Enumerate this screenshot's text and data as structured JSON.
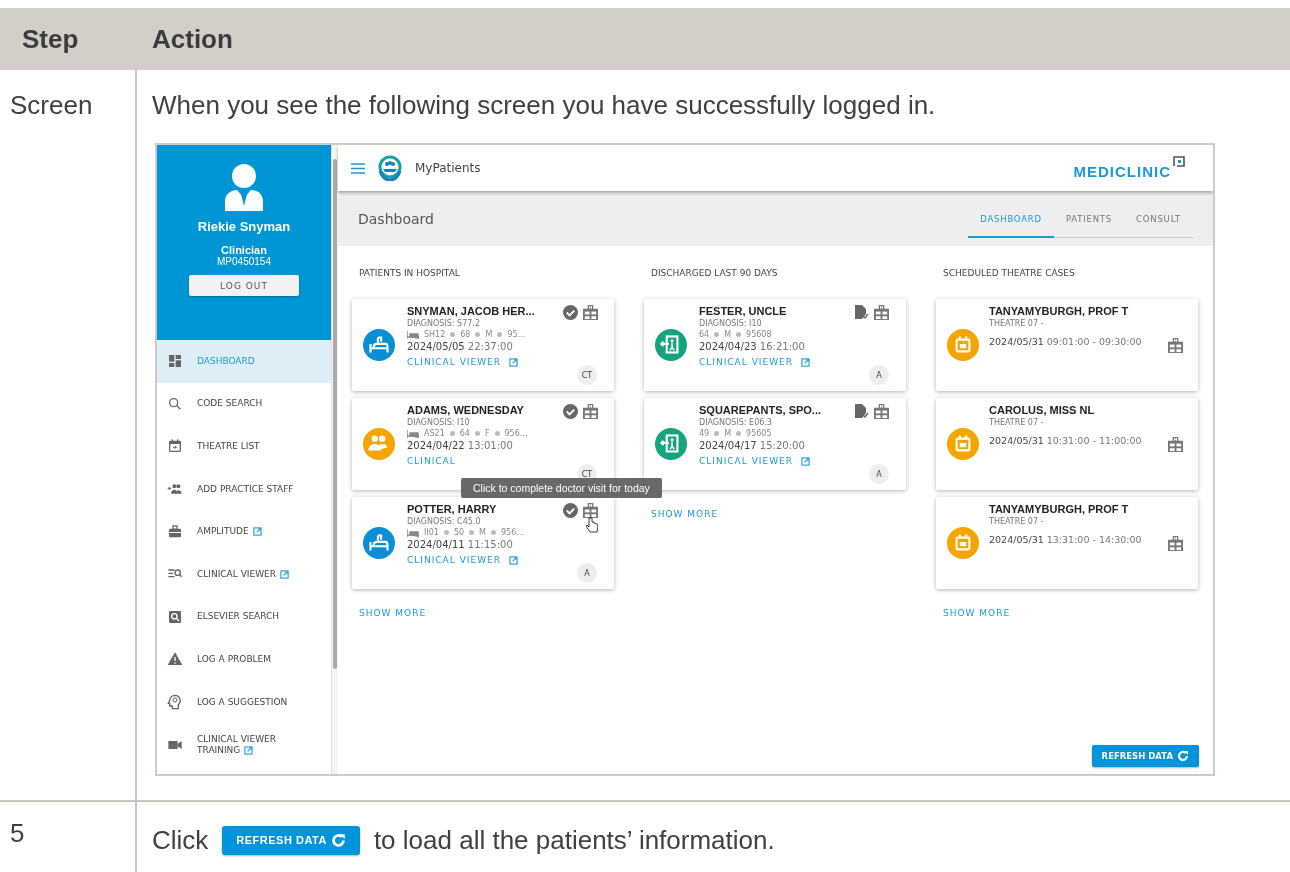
{
  "table": {
    "columns": [
      "Step",
      "Action"
    ],
    "rows": [
      {
        "step": "Screen",
        "text": "When you see the following screen you have successfully logged in.",
        "screenshot": {
          "sidebar": {
            "user": {
              "name": "Riekie Snyman",
              "role": "Clinician",
              "id": "MP0450154"
            },
            "logout": "LOG OUT",
            "items": [
              {
                "label": "DASHBOARD",
                "selected": true,
                "external": false
              },
              {
                "label": "CODE SEARCH",
                "selected": false,
                "external": false
              },
              {
                "label": "THEATRE LIST",
                "selected": false,
                "external": false
              },
              {
                "label": "ADD PRACTICE STAFF",
                "selected": false,
                "external": false
              },
              {
                "label": "AMPLITUDE",
                "selected": false,
                "external": true
              },
              {
                "label": "CLINICAL VIEWER",
                "selected": false,
                "external": true
              },
              {
                "label": "ELSEVIER SEARCH",
                "selected": false,
                "external": false
              },
              {
                "label": "LOG A PROBLEM",
                "selected": false,
                "external": false
              },
              {
                "label": "LOG A SUGGESTION",
                "selected": false,
                "external": false
              },
              {
                "label": "CLINICAL VIEWER TRAINING",
                "selected": false,
                "external": true
              }
            ]
          },
          "app_title": "MyPatients",
          "brand": "MEDICLINIC",
          "page_title": "Dashboard",
          "tabs": [
            {
              "label": "DASHBOARD",
              "selected": true
            },
            {
              "label": "PATIENTS",
              "selected": false
            },
            {
              "label": "CONSULT",
              "selected": false
            }
          ],
          "sections": [
            {
              "title": "PATIENTS IN HOSPITAL",
              "show_more": "SHOW MORE",
              "cards": [
                {
                  "kind": "admitted",
                  "name": "SNYMAN, JACOB HER...",
                  "diagnosis": "DIAGNOSIS: S77.2",
                  "details": [
                    "SH12",
                    "68",
                    "M",
                    "95..."
                  ],
                  "date": "2024/05/05",
                  "time": "22:37:00",
                  "link": "CLINICAL VIEWER",
                  "badge": "CT"
                },
                {
                  "kind": "referred",
                  "name": "ADAMS, WEDNESDAY",
                  "diagnosis": "DIAGNOSIS: I10",
                  "details": [
                    "AS21",
                    "64",
                    "F",
                    "956..."
                  ],
                  "date": "2024/04/22",
                  "time": "13:01:00",
                  "link": "CLINICAL",
                  "badge": "CT"
                },
                {
                  "kind": "admitted",
                  "name": "POTTER, HARRY",
                  "diagnosis": "DIAGNOSIS: C45.0",
                  "details": [
                    "II01",
                    "50",
                    "M",
                    "956..."
                  ],
                  "date": "2024/04/11",
                  "time": "11:15:00",
                  "link": "CLINICAL VIEWER",
                  "badge": "A"
                }
              ]
            },
            {
              "title": "DISCHARGED LAST 90 DAYS",
              "show_more": "SHOW MORE",
              "cards": [
                {
                  "kind": "discharged",
                  "name": "FESTER, UNCLE",
                  "diagnosis": "DIAGNOSIS: I10",
                  "details": [
                    "64",
                    "M",
                    "95608"
                  ],
                  "date": "2024/04/23",
                  "time": "16:21:00",
                  "link": "CLINICAL VIEWER",
                  "badge": "A"
                },
                {
                  "kind": "discharged",
                  "name": "SQUAREPANTS, SPO...",
                  "diagnosis": "DIAGNOSIS: E06.3",
                  "details": [
                    "49",
                    "M",
                    "95605"
                  ],
                  "date": "2024/04/17",
                  "time": "15:20:00",
                  "link": "CLINICAL VIEWER",
                  "badge": "A"
                }
              ]
            },
            {
              "title": "SCHEDULED THEATRE CASES",
              "show_more": "SHOW MORE",
              "cards": [
                {
                  "kind": "theatre",
                  "name": "TANYAMYBURGH, PROF T",
                  "theatre": "THEATRE 07 -",
                  "date": "2024/05/31",
                  "time": "09:01:00 - 09:30:00"
                },
                {
                  "kind": "theatre",
                  "name": "CAROLUS, MISS NL",
                  "theatre": "THEATRE 07 -",
                  "date": "2024/05/31",
                  "time": "10:31:00 - 11:00:00"
                },
                {
                  "kind": "theatre",
                  "name": "TANYAMYBURGH, PROF T",
                  "theatre": "THEATRE 07 -",
                  "date": "2024/05/31",
                  "time": "13:31:00 - 14:30:00"
                }
              ]
            }
          ],
          "tooltip": "Click to complete doctor visit for today",
          "refresh_button": "REFRESH DATA"
        }
      },
      {
        "step": "5",
        "before": "Click",
        "button": "REFRESH DATA",
        "after": "to load all the patients’ information."
      }
    ]
  }
}
